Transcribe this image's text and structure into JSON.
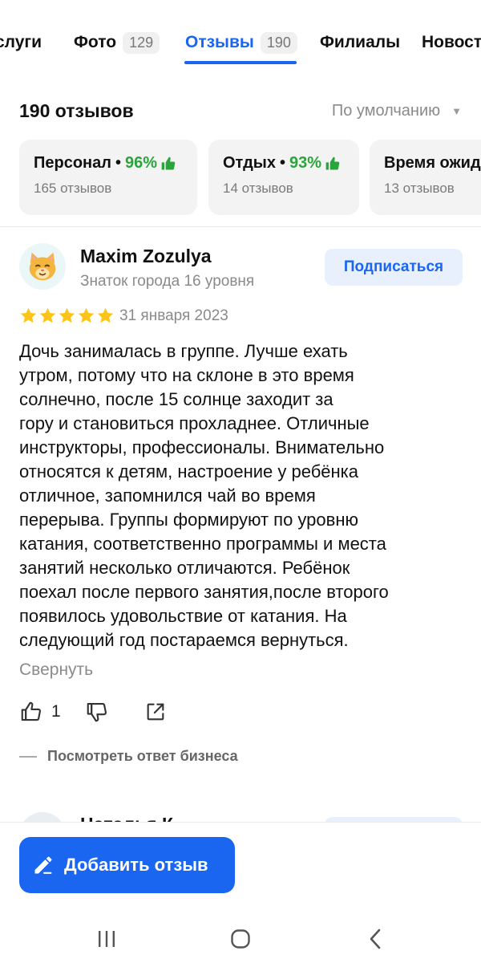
{
  "tabs": [
    {
      "label": "Услуги",
      "visible_label": "слуги"
    },
    {
      "label": "Фото",
      "count": "129"
    },
    {
      "label": "Отзывы",
      "count": "190",
      "active": true
    },
    {
      "label": "Филиалы"
    },
    {
      "label": "Новост"
    }
  ],
  "header": {
    "reviews_count": "190 отзывов",
    "sort_label": "По умолчанию"
  },
  "aspects": [
    {
      "name": "Персонал",
      "percent": "96%",
      "reviews": "165 отзывов",
      "sentiment": "positive"
    },
    {
      "name": "Отдых",
      "percent": "93%",
      "reviews": "14 отзывов",
      "sentiment": "positive"
    },
    {
      "name": "Время ожид",
      "reviews": "13 отзывов"
    }
  ],
  "review": {
    "author": "Maxim Zozulya",
    "level": "Знаток города 16 уровня",
    "subscribe_label": "Подписаться",
    "rating": 5,
    "date": "31 января 2023",
    "text": "Дочь занималась в группе. Лучше ехать\nутром, потому что на склоне в это время\nсолнечно, после 15 солнце заходит за\nгору и становиться прохладнее. Отличные\nинструкторы, профессионалы. Внимательно\nотносятся к детям, настроение у ребёнка\nотличное, запомнился чай во время\nперерыва. Группы формируют по уровню\nкатания, соответственно программы и места\nзанятий несколько отличаются. Ребёнок\nпоехал после первого занятия,после второго\nпоявилось удовольствие от катания. На\nследующий год постараемся вернуться.",
    "collapse_label": "Свернуть",
    "likes": "1",
    "business_reply_label": "Посмотреть ответ бизнеса"
  },
  "next_review": {
    "author_partial": "Наталья К"
  },
  "bottom": {
    "add_review_label": "Добавить отзыв"
  },
  "colors": {
    "accent": "#1a66f0",
    "positive": "#2aa53b",
    "star": "#fcc419"
  },
  "icons": [
    "thumbs-up-icon",
    "thumbs-down-icon",
    "share-icon",
    "pencil-icon",
    "recent-apps-icon",
    "home-icon",
    "back-icon"
  ]
}
